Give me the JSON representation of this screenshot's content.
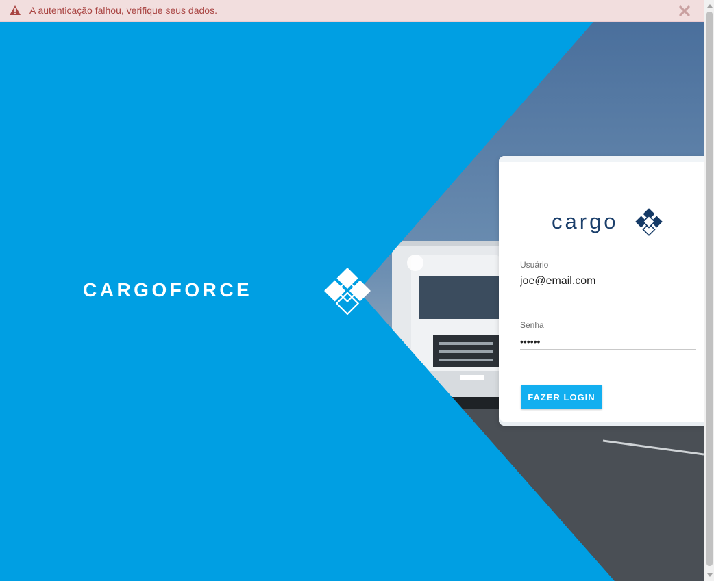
{
  "alert": {
    "message": "A autenticação falhou, verifique seus dados.",
    "icon": "warning-icon",
    "close_icon": "close-icon",
    "colors": {
      "background": "#f2dede",
      "text": "#a94442"
    }
  },
  "hero": {
    "title": "CARGOFORCE",
    "background_color": "#009fe3"
  },
  "login": {
    "logo_text": "cargo",
    "username": {
      "label": "Usuário",
      "value": "joe@email.com"
    },
    "password": {
      "label": "Senha",
      "value": "••••••"
    },
    "submit_label": "FAZER LOGIN",
    "accent_color": "#13aff0"
  }
}
